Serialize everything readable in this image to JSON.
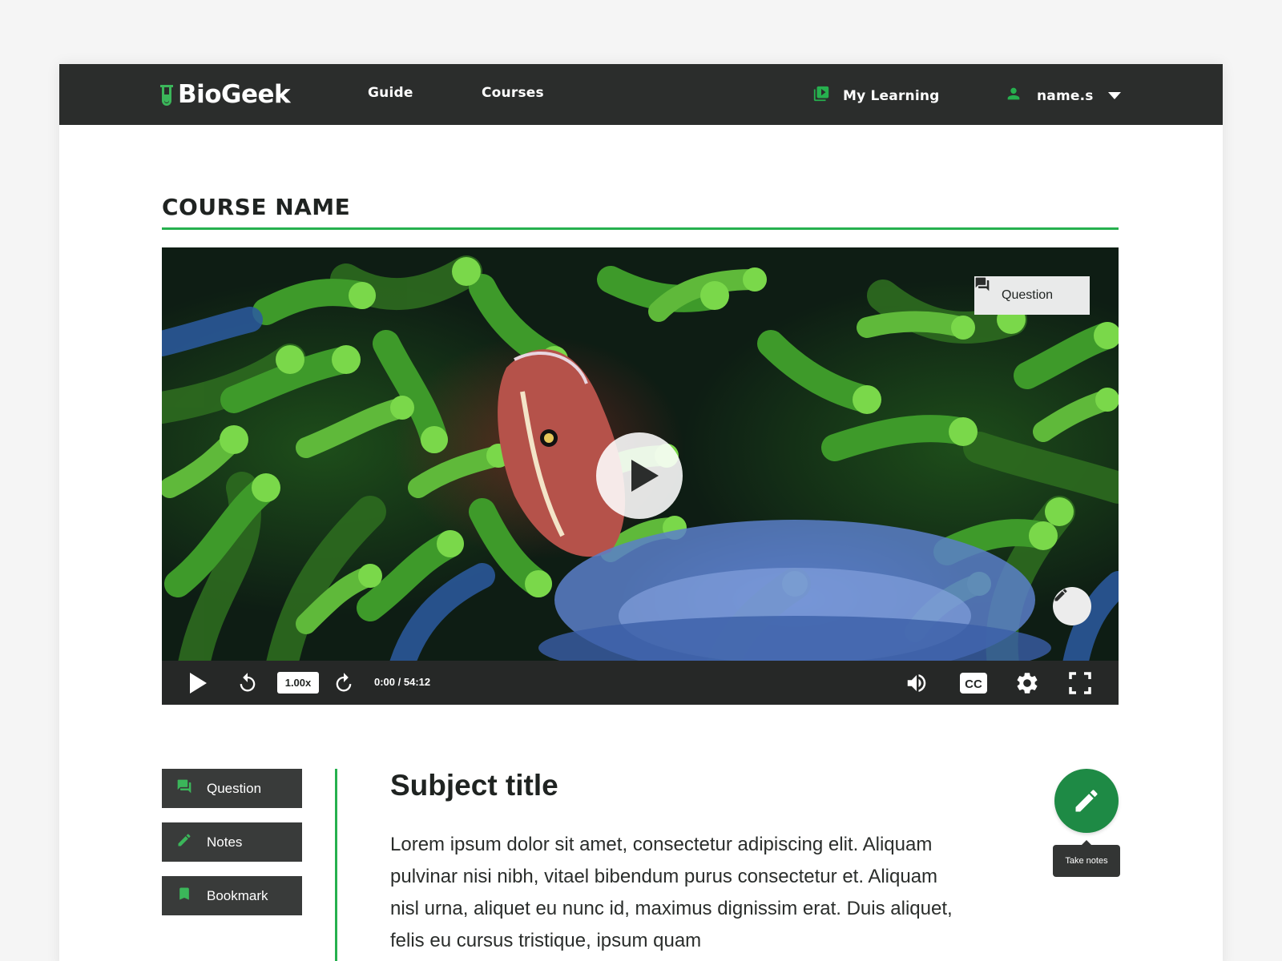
{
  "brand": {
    "name": "BioGeek",
    "accent": "#26b04e"
  },
  "nav": {
    "guide": "Guide",
    "courses": "Courses",
    "my_learning": "My Learning",
    "username": "name.s"
  },
  "course": {
    "title": "COURSE NAME"
  },
  "player": {
    "question_label": "Question",
    "speed": "1.00x",
    "time": "0:00 / 54:12",
    "icons": [
      "play-icon",
      "rewind-icon",
      "forward-icon",
      "volume-icon",
      "cc-icon",
      "settings-icon",
      "fullscreen-icon",
      "pencil-icon"
    ]
  },
  "sidebar": {
    "question": "Question",
    "notes": "Notes",
    "bookmark": "Bookmark"
  },
  "content": {
    "subject_title": "Subject title",
    "body": "Lorem ipsum dolor sit amet, consectetur adipiscing elit. Aliquam pulvinar nisi nibh, vitael bibendum purus consectetur et. Aliquam nisl urna, aliquet eu nunc id, maximus dignissim erat. Duis aliquet, felis eu cursus tristique, ipsum quam"
  },
  "take_notes": {
    "tooltip": "Take notes"
  }
}
